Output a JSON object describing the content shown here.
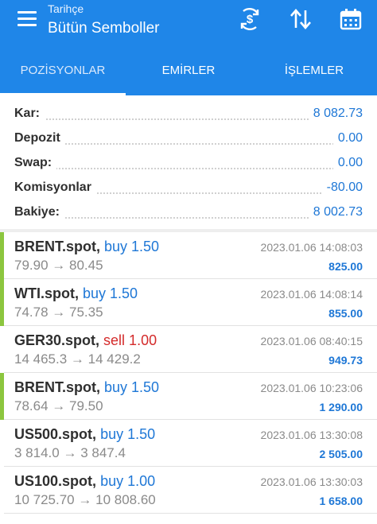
{
  "header": {
    "subtitle": "Tarihçe",
    "title": "Bütün Semboller",
    "icons": [
      "menu-icon",
      "currency-exchange-icon",
      "sort-icon",
      "calendar-icon"
    ]
  },
  "tabs": [
    {
      "label": "POZİSYONLAR",
      "active": true
    },
    {
      "label": "EMİRLER",
      "active": false
    },
    {
      "label": "İŞLEMLER",
      "active": false
    }
  ],
  "summary": [
    {
      "label": "Kar:",
      "value": "8 082.73"
    },
    {
      "label": "Depozit",
      "value": "0.00"
    },
    {
      "label": "Swap:",
      "value": "0.00"
    },
    {
      "label": "Komisyonlar",
      "value": "-80.00"
    },
    {
      "label": "Bakiye:",
      "value": "8 002.73"
    }
  ],
  "trades": [
    {
      "symbol": "BRENT.spot,",
      "side": "buy 1.50",
      "side_type": "buy",
      "open": "79.90",
      "close": "80.45",
      "arrow": "→",
      "time": "2023.01.06 14:08:03",
      "profit": "825.00",
      "accent": "#8cc63f"
    },
    {
      "symbol": "WTI.spot,",
      "side": "buy 1.50",
      "side_type": "buy",
      "open": "74.78",
      "close": "75.35",
      "arrow": "→",
      "time": "2023.01.06 14:08:14",
      "profit": "855.00",
      "accent": "#8cc63f"
    },
    {
      "symbol": "GER30.spot,",
      "side": "sell 1.00",
      "side_type": "sell",
      "open": "14 465.3",
      "close": "14 429.2",
      "arrow": "→",
      "time": "2023.01.06 08:40:15",
      "profit": "949.73",
      "accent": "#ffffff"
    },
    {
      "symbol": "BRENT.spot,",
      "side": "buy 1.50",
      "side_type": "buy",
      "open": "78.64",
      "close": "79.50",
      "arrow": "→",
      "time": "2023.01.06 10:23:06",
      "profit": "1 290.00",
      "accent": "#8cc63f"
    },
    {
      "symbol": "US500.spot,",
      "side": "buy 1.50",
      "side_type": "buy",
      "open": "3 814.0",
      "close": "3 847.4",
      "arrow": "→",
      "time": "2023.01.06 13:30:08",
      "profit": "2 505.00",
      "accent": "#ffffff"
    },
    {
      "symbol": "US100.spot,",
      "side": "buy 1.00",
      "side_type": "buy",
      "open": "10 725.70",
      "close": "10 808.60",
      "arrow": "→",
      "time": "2023.01.06 13:30:03",
      "profit": "1 658.00",
      "accent": "#ffffff"
    }
  ],
  "colors": {
    "primary": "#1f86e8",
    "buy": "#1e77d6",
    "sell": "#d42b2b",
    "accent_green": "#8cc63f"
  }
}
